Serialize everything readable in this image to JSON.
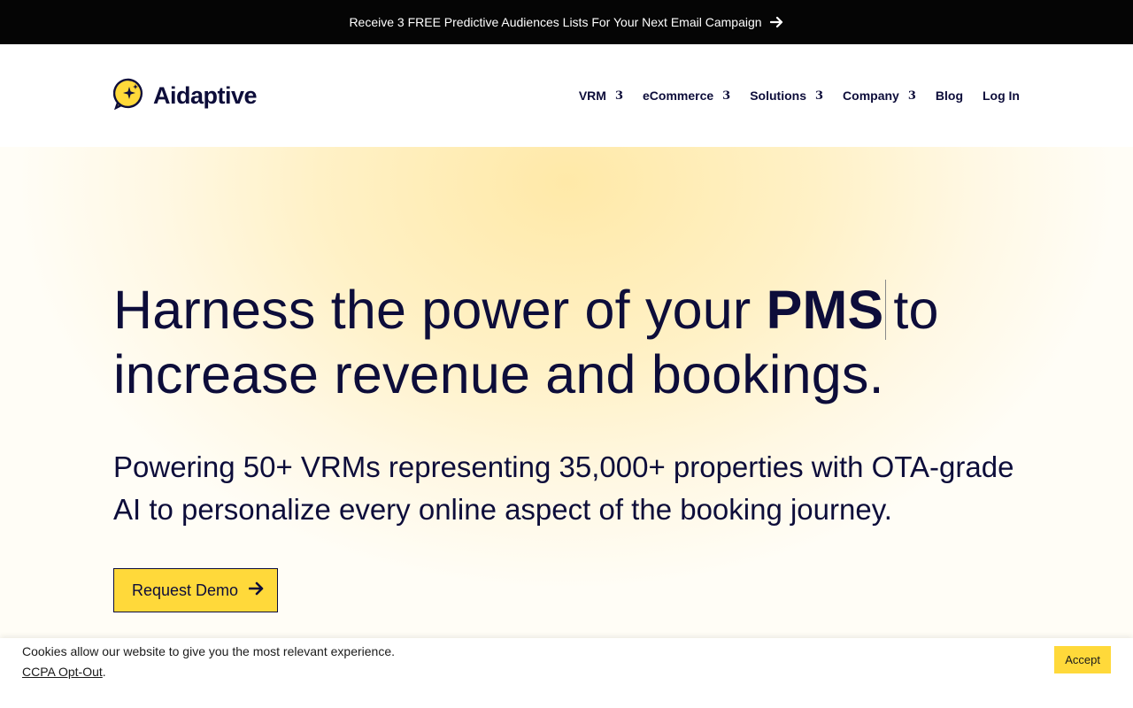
{
  "promo": {
    "text": "Receive 3 FREE Predictive Audiences Lists For Your Next Email Campaign",
    "icon": "arrow-right-icon"
  },
  "header": {
    "logo_text": "Aidaptive",
    "nav": [
      {
        "label": "VRM",
        "caret": "3"
      },
      {
        "label": "eCommerce",
        "caret": "3"
      },
      {
        "label": "Solutions",
        "caret": "3"
      },
      {
        "label": "Company",
        "caret": "3"
      },
      {
        "label": "Blog"
      },
      {
        "label": "Log In"
      }
    ]
  },
  "hero": {
    "title_start": "Harness the power of your ",
    "title_rotating": "PMS",
    "title_end": "to increase revenue and bookings.",
    "subtitle": "Powering 50+ VRMs representing 35,000+ properties with OTA-grade AI to personalize every online aspect of the booking journey.",
    "cta_label": "Request Demo"
  },
  "cookie": {
    "message": "Cookies allow our website to give you the most relevant experience.",
    "link_label": "CCPA Opt-Out",
    "period": ".",
    "accept_label": "Accept"
  },
  "colors": {
    "accent": "#ffd93a",
    "text": "#0d0d3a",
    "promo_bg": "#050505"
  }
}
